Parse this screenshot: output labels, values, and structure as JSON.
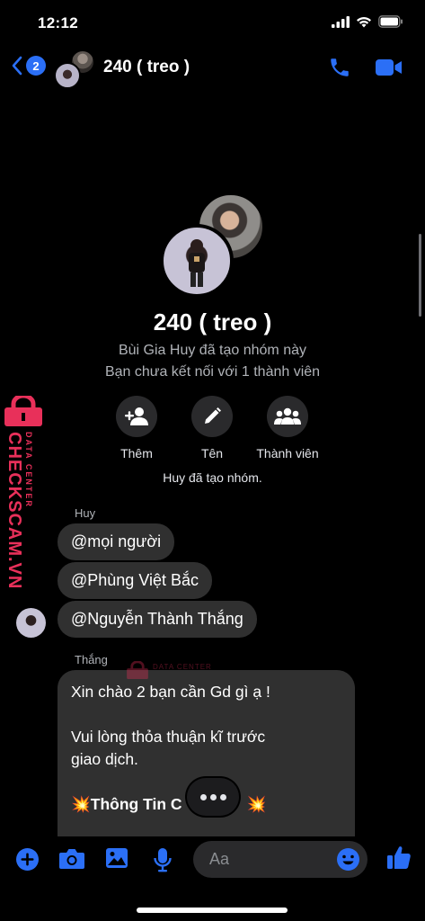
{
  "status": {
    "time": "12:12"
  },
  "header": {
    "back_badge": "2",
    "title": "240 ( treo )"
  },
  "group": {
    "title": "240 ( treo )",
    "created_by": "Bùi Gia Huy đã tạo nhóm này",
    "not_connected": "Bạn chưa kết nối với 1 thành viên"
  },
  "actions": [
    {
      "label": "Thêm",
      "icon": "add-person-icon"
    },
    {
      "label": "Tên",
      "icon": "pencil-icon"
    },
    {
      "label": "Thành viên",
      "icon": "group-icon"
    }
  ],
  "system_message": "Huy đã tạo nhóm.",
  "messages": {
    "sender1": "Huy",
    "huy": [
      "@mọi người",
      "@Phùng Việt Bắc",
      "@Nguyễn Thành Thắng"
    ],
    "sender2": "Thắng",
    "thang_line1": "Xin chào 2 bạn cần Gd gì ạ !",
    "thang_line2": "Vui lòng  thỏa thuận kĩ trước",
    "thang_line3": "giao dịch.",
    "thang_line4_prefix": "Thông Tin C",
    "emoji": "💥"
  },
  "watermark": {
    "text": "CHECKSCAM.VN",
    "sub": "DATA CENTER",
    "small": "DATA CENTER"
  },
  "composer": {
    "placeholder": "Aa"
  },
  "colors": {
    "accent": "#2b6ff6",
    "bubble": "#303030",
    "watermark": "#e8305a"
  }
}
